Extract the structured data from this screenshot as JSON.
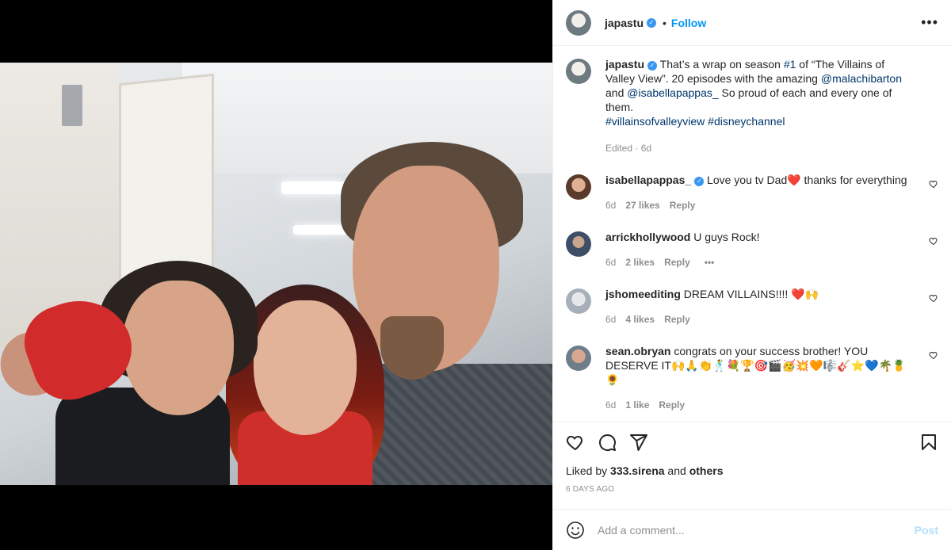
{
  "post": {
    "author": "japastu",
    "follow_label": "Follow",
    "dot": "•",
    "more_label": "•••"
  },
  "caption": {
    "username": "japastu",
    "text_1": " That’s a wrap on season ",
    "tag_1": "#1",
    "text_2": " of “The Villains of Valley View”. 20 episodes with the amazing ",
    "mention_1": "@malachibarton",
    "text_3": " and ",
    "mention_2": "@isabellapappas_",
    "text_4": " So proud of each and every one of them.",
    "hashtag_1": "#villainsofvalleyview",
    "hashtag_2": "#disneychannel",
    "meta": "Edited · 6d"
  },
  "comments": [
    {
      "username": "isabellapappas_",
      "text": " Love you tv Dad❤️ thanks for everything",
      "time": "6d",
      "likes": "27 likes",
      "reply": "Reply"
    },
    {
      "username": "arrickhollywood",
      "text": " U guys Rock!",
      "time": "6d",
      "likes": "2 likes",
      "reply": "Reply",
      "more": "•••"
    },
    {
      "username": "jshomeediting",
      "text": " DREAM VILLAINS!!!! ❤️🙌",
      "time": "6d",
      "likes": "4 likes",
      "reply": "Reply"
    },
    {
      "username": "sean.obryan",
      "text": " congrats on your success brother! YOU DESERVE IT🙌🙏👏🕺💐🏆🎯🎬🥳💥🧡🎼🎸⭐💙🌴🍍🌻",
      "time": "6d",
      "likes": "1 like",
      "reply": "Reply"
    }
  ],
  "actions": {
    "liked_prefix": "Liked by ",
    "liked_user": "333.sirena",
    "liked_mid": " and ",
    "liked_others": "others",
    "ago": "6 DAYS AGO"
  },
  "add_comment": {
    "placeholder": "Add a comment...",
    "post_label": "Post"
  },
  "icons": {
    "like": "heart-icon",
    "comment": "comment-icon",
    "share": "share-icon",
    "save": "bookmark-icon",
    "emoji": "emoji-icon",
    "verified": "verified-icon"
  },
  "colors": {
    "accent": "#0095f6",
    "link": "#00376b",
    "muted": "#8e8e8e",
    "post_disabled": "#b2dffc",
    "verified": "#3897f0"
  }
}
